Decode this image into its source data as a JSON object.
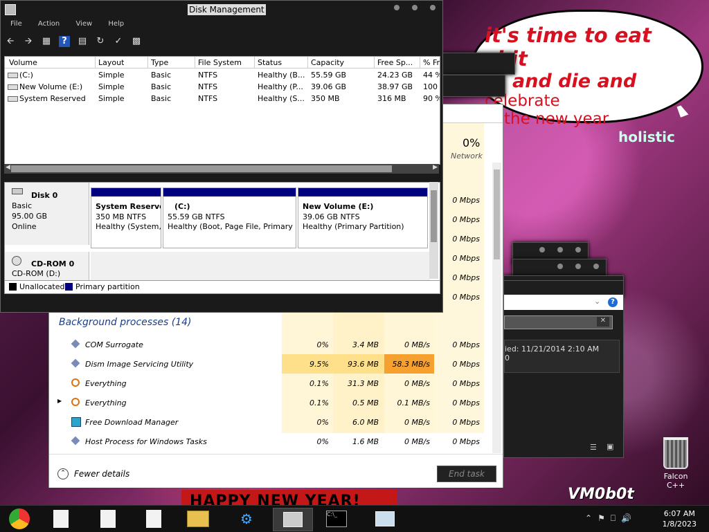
{
  "desktop": {
    "bubble_line1": "it's time to eat shit",
    "bubble_line2": "and die and",
    "bubble_line2b": "celebrate",
    "bubble_line3": "the new year",
    "banner_text": "HAPPY NEW YEAR!",
    "logo_text": "VM0b0t",
    "recycle_label": "Falcon C++",
    "holistic_text": "holistic"
  },
  "disk_management": {
    "title": "Disk Management",
    "menu": [
      "File",
      "Action",
      "View",
      "Help"
    ],
    "columns": [
      "Volume",
      "Layout",
      "Type",
      "File System",
      "Status",
      "Capacity",
      "Free Sp...",
      "% Fr"
    ],
    "volumes": [
      {
        "volume": "(C:)",
        "layout": "Simple",
        "type": "Basic",
        "fs": "NTFS",
        "status": "Healthy (B...",
        "capacity": "55.59 GB",
        "free": "24.23 GB",
        "pct": "44 %"
      },
      {
        "volume": "New Volume (E:)",
        "layout": "Simple",
        "type": "Basic",
        "fs": "NTFS",
        "status": "Healthy (P...",
        "capacity": "39.06 GB",
        "free": "38.97 GB",
        "pct": "100 %"
      },
      {
        "volume": "System Reserved",
        "layout": "Simple",
        "type": "Basic",
        "fs": "NTFS",
        "status": "Healthy (S...",
        "capacity": "350 MB",
        "free": "316 MB",
        "pct": "90 %"
      }
    ],
    "disk0": {
      "name": "Disk 0",
      "type": "Basic",
      "size": "95.00 GB",
      "state": "Online",
      "partitions": [
        {
          "name": "System Reserved",
          "size": "350 MB NTFS",
          "status": "Healthy (System, Active, Primary Partition)"
        },
        {
          "name": "(C:)",
          "size": "55.59 GB NTFS",
          "status": "Healthy (Boot, Page File, Primary Partition)"
        },
        {
          "name": "New Volume  (E:)",
          "size": "39.06 GB NTFS",
          "status": "Healthy (Primary Partition)"
        }
      ]
    },
    "cdrom": {
      "name": "CD-ROM 0",
      "drive": "CD-ROM (D:)"
    },
    "legend": [
      "Unallocated",
      "Primary partition"
    ],
    "colors": {
      "primary": "#000080",
      "unallocated": "#000000"
    }
  },
  "task_manager": {
    "network_pct": "0%",
    "network_label": "Network",
    "upper_network": [
      "0 Mbps",
      "0 Mbps",
      "0 Mbps",
      "0 Mbps",
      "0 Mbps",
      "0 Mbps"
    ],
    "section_title": "Background processes (14)",
    "processes": [
      {
        "name": "COM Surrogate",
        "cpu": "0%",
        "mem": "3.4 MB",
        "disk": "0 MB/s",
        "net": "0 Mbps",
        "icon": "diamond-icon",
        "expand": false
      },
      {
        "name": "Dism Image Servicing Utility",
        "cpu": "9.5%",
        "mem": "93.6 MB",
        "disk": "58.3 MB/s",
        "net": "0 Mbps",
        "icon": "diamond-icon",
        "expand": false
      },
      {
        "name": "Everything",
        "cpu": "0.1%",
        "mem": "31.3 MB",
        "disk": "0 MB/s",
        "net": "0 Mbps",
        "icon": "magnifier-icon",
        "expand": false
      },
      {
        "name": "Everything",
        "cpu": "0.1%",
        "mem": "0.5 MB",
        "disk": "0.1 MB/s",
        "net": "0 Mbps",
        "icon": "magnifier-icon",
        "expand": true
      },
      {
        "name": "Free Download Manager",
        "cpu": "0%",
        "mem": "6.0 MB",
        "disk": "0 MB/s",
        "net": "0 Mbps",
        "icon": "download-icon",
        "expand": false
      },
      {
        "name": "Host Process for Windows Tasks",
        "cpu": "0%",
        "mem": "1.6 MB",
        "disk": "0 MB/s",
        "net": "0 Mbps",
        "icon": "diamond-icon",
        "expand": false
      }
    ],
    "fewer_details": "Fewer details",
    "end_task": "End task"
  },
  "properties": {
    "info_text": "ied: 11/21/2014 2:10 AM",
    "info_text2": "0"
  },
  "taskbar": {
    "time": "6:07 AM",
    "date": "1/8/2023"
  }
}
